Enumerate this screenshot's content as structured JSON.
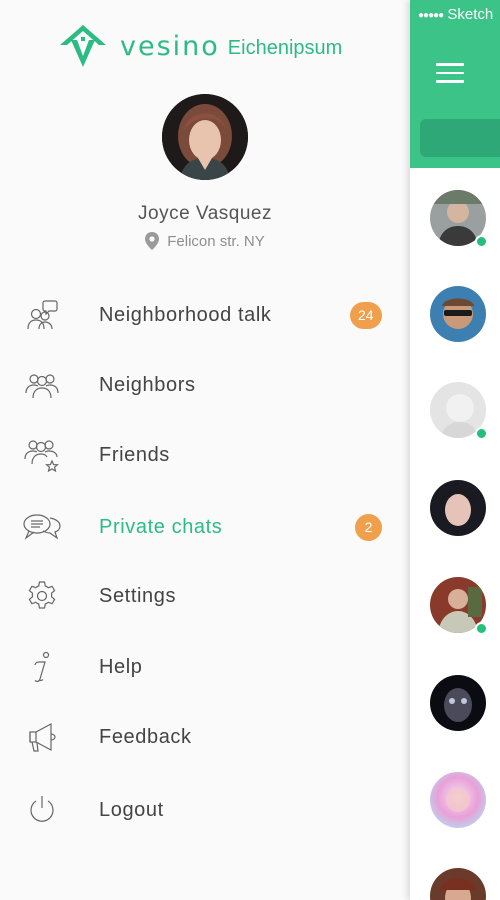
{
  "colors": {
    "accent": "#2dbb84",
    "badge": "#f0a04c",
    "header": "#3cc387",
    "search_pill": "#2ea877",
    "icon_stroke": "#666666",
    "online": "#21c17a"
  },
  "brand": {
    "wordmark": "vesino",
    "location": "Eichenipsum",
    "logo_icon": "house-v-logo"
  },
  "profile": {
    "name": "Joyce Vasquez",
    "location": "Felicon str. NY",
    "location_icon": "map-pin-icon"
  },
  "menu": {
    "items": [
      {
        "label": "Neighborhood talk",
        "icon": "neighborhood-talk-icon",
        "badge": "24",
        "active": false
      },
      {
        "label": "Neighbors",
        "icon": "group-icon",
        "badge": "",
        "active": false
      },
      {
        "label": "Friends",
        "icon": "friends-star-icon",
        "badge": "",
        "active": false
      },
      {
        "label": "Private chats",
        "icon": "chat-bubbles-icon",
        "badge": "2",
        "active": true
      },
      {
        "label": "Settings",
        "icon": "gear-icon",
        "badge": "",
        "active": false
      },
      {
        "label": "Help",
        "icon": "info-icon",
        "badge": "",
        "active": false
      },
      {
        "label": "Feedback",
        "icon": "megaphone-icon",
        "badge": "",
        "active": false
      },
      {
        "label": "Logout",
        "icon": "power-icon",
        "badge": "",
        "active": false
      }
    ]
  },
  "screen": {
    "status_text": "Sketch",
    "menu_icon": "hamburger-icon",
    "contacts": [
      {
        "online": true
      },
      {
        "online": false
      },
      {
        "online": true
      },
      {
        "online": false
      },
      {
        "online": true
      },
      {
        "online": false
      },
      {
        "online": false
      },
      {
        "online": false
      }
    ]
  }
}
